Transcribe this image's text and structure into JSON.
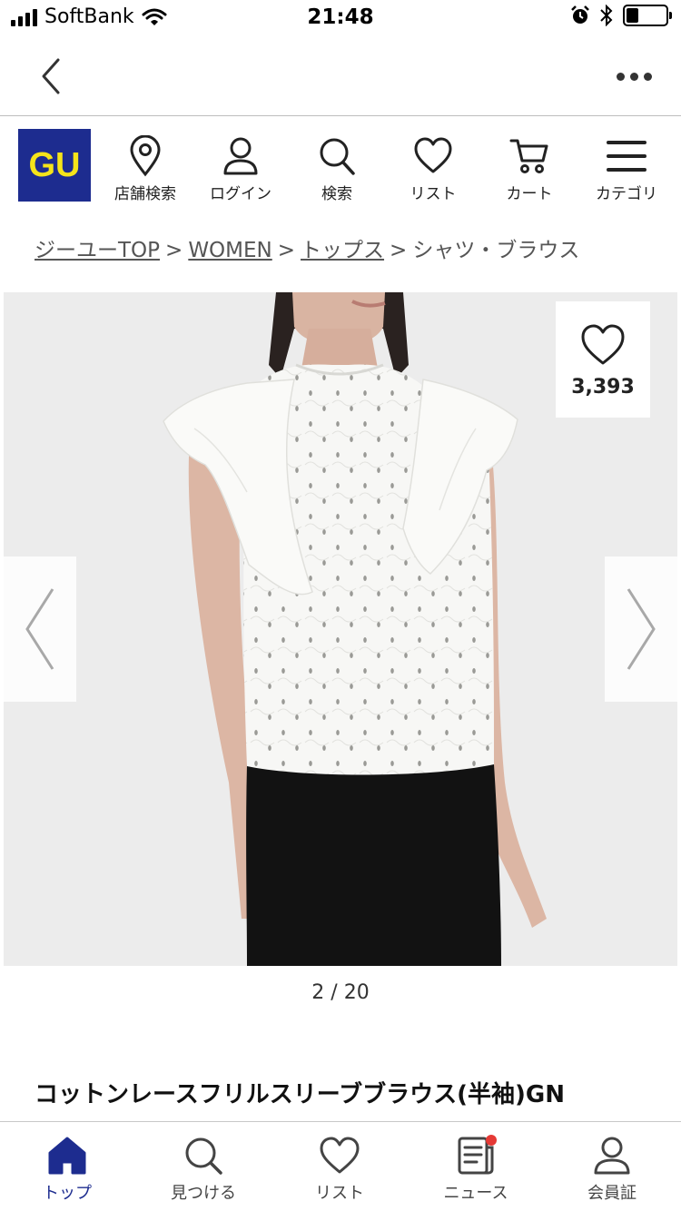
{
  "status_bar": {
    "carrier": "SoftBank",
    "time": "21:48",
    "battery_level": 0.3
  },
  "header": {
    "logo_text": "GU",
    "menu": [
      {
        "label": "店舗検索",
        "icon": "location-pin-icon"
      },
      {
        "label": "ログイン",
        "icon": "user-icon"
      },
      {
        "label": "検索",
        "icon": "search-icon"
      },
      {
        "label": "リスト",
        "icon": "heart-icon"
      },
      {
        "label": "カート",
        "icon": "cart-icon"
      },
      {
        "label": "カテゴリ",
        "icon": "hamburger-menu-icon"
      }
    ]
  },
  "breadcrumb": {
    "items": [
      "ジーユーTOP",
      "WOMEN",
      "トップス",
      "シャツ・ブラウス"
    ],
    "separator": ">"
  },
  "gallery": {
    "favorite_count": "3,393",
    "pager": "2 / 20"
  },
  "product": {
    "title": "コットンレースフリルスリーブブラウス(半袖)GN"
  },
  "tab_bar": {
    "tabs": [
      {
        "label": "トップ",
        "icon": "home-icon",
        "active": true
      },
      {
        "label": "見つける",
        "icon": "search-icon",
        "active": false
      },
      {
        "label": "リスト",
        "icon": "heart-icon",
        "active": false
      },
      {
        "label": "ニュース",
        "icon": "news-icon",
        "active": false,
        "badge": true
      },
      {
        "label": "会員証",
        "icon": "member-icon",
        "active": false
      }
    ]
  },
  "colors": {
    "brand_navy": "#1d2c8f",
    "brand_yellow": "#f5e41a",
    "badge_red": "#e53935"
  }
}
